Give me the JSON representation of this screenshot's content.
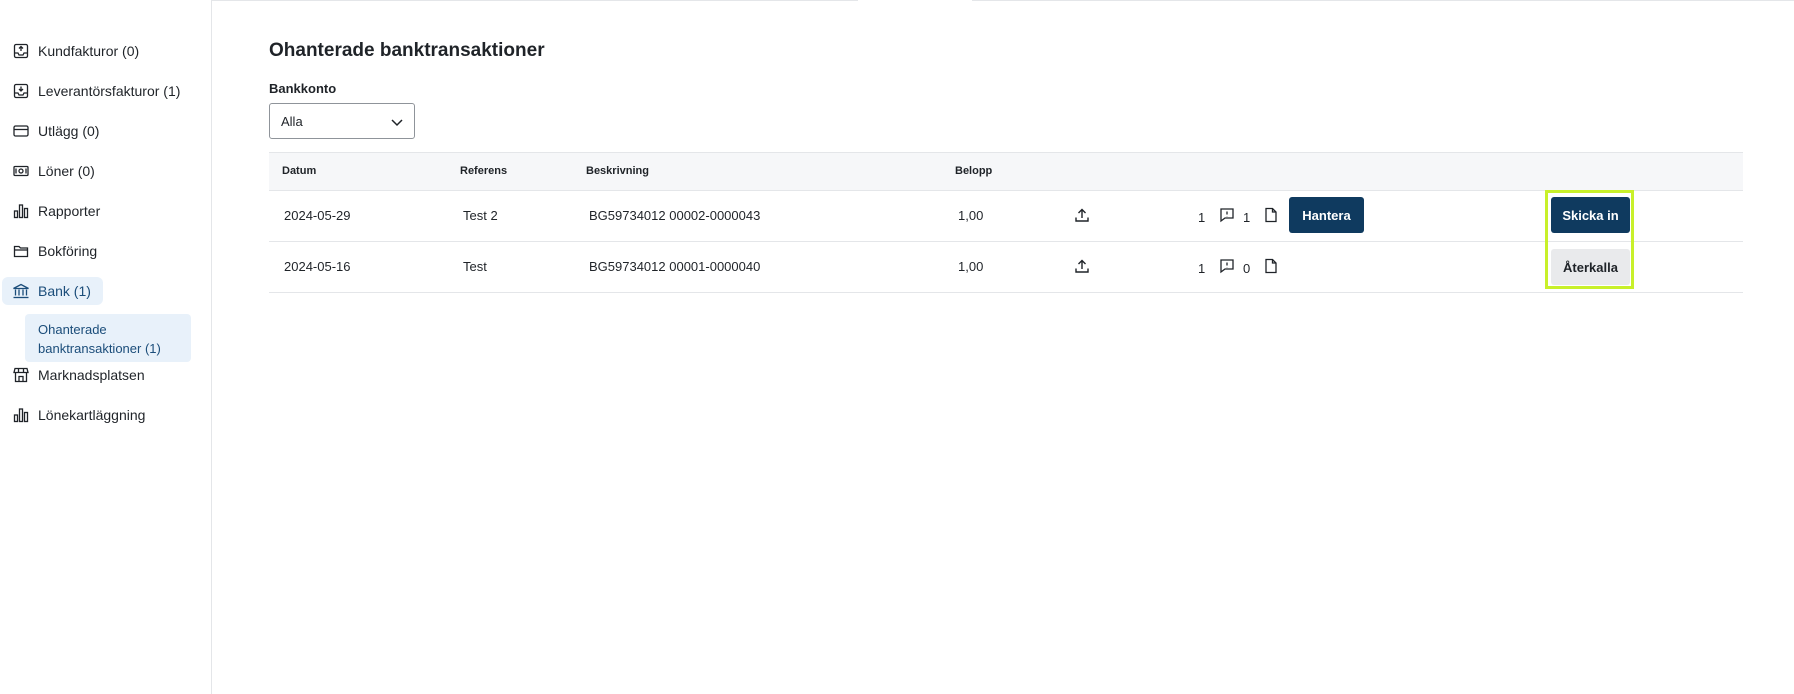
{
  "sidebar": {
    "items": [
      {
        "label": "Kundfakturor (0)",
        "icon": "invoice-out-icon"
      },
      {
        "label": "Leverantörsfakturor (1)",
        "icon": "invoice-in-icon"
      },
      {
        "label": "Utlägg (0)",
        "icon": "card-icon"
      },
      {
        "label": "Löner (0)",
        "icon": "money-icon"
      },
      {
        "label": "Rapporter",
        "icon": "bar-chart-icon"
      },
      {
        "label": "Bokföring",
        "icon": "folder-icon"
      },
      {
        "label": "Bank (1)",
        "icon": "bank-icon"
      },
      {
        "label": "Marknadsplatsen",
        "icon": "store-icon"
      },
      {
        "label": "Lönekartläggning",
        "icon": "bar-chart-icon"
      }
    ],
    "sub_item": {
      "line1": "Ohanterade",
      "line2": "banktransaktioner (1)"
    }
  },
  "main": {
    "title": "Ohanterade banktransaktioner",
    "bank_label": "Bankkonto",
    "bank_select": "Alla",
    "columns": {
      "date": "Datum",
      "reference": "Referens",
      "description": "Beskrivning",
      "amount": "Belopp"
    },
    "rows": [
      {
        "date": "2024-05-29",
        "reference": "Test 2",
        "description": "BG59734012 00002-0000043",
        "amount": "1,00",
        "attachments": "1",
        "comments": "1",
        "handle_label": "Hantera",
        "action_label": "Skicka in"
      },
      {
        "date": "2024-05-16",
        "reference": "Test",
        "description": "BG59734012 00001-0000040",
        "amount": "1,00",
        "attachments": "1",
        "comments": "0",
        "action_label": "Återkalla"
      }
    ]
  },
  "colors": {
    "primary": "#0f3a5f",
    "active_bg": "#e8f1fa",
    "highlight": "#c8f02a"
  }
}
